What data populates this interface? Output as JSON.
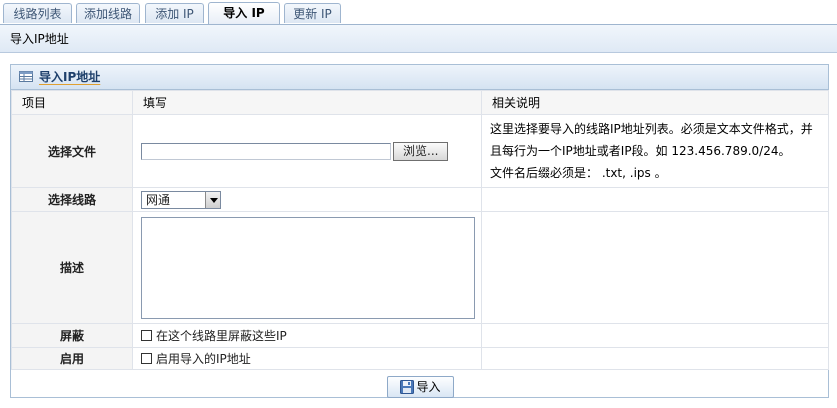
{
  "tabs": [
    {
      "label": "线路列表",
      "active": false
    },
    {
      "label": "添加线路",
      "active": false
    },
    {
      "label": "添加 IP",
      "active": false
    },
    {
      "label": "导入 IP",
      "active": true
    },
    {
      "label": "更新 IP",
      "active": false
    }
  ],
  "subheader": {
    "title": "导入IP地址"
  },
  "panel": {
    "title": "导入IP地址",
    "columns": {
      "item": "项目",
      "fill": "填写",
      "description": "相关说明"
    },
    "rows": {
      "file": {
        "label": "选择文件",
        "browse_label": "浏览...",
        "note_line1": "这里选择要导入的线路IP地址列表。必须是文本文件格式，并",
        "note_line2": "且每行为一个IP地址或者IP段。如 123.456.789.0/24。",
        "note_line3": "文件名后缀必须是： .txt, .ips 。"
      },
      "line": {
        "label": "选择线路",
        "selected": "网通"
      },
      "desc": {
        "label": "描述"
      },
      "block": {
        "label": "屏蔽",
        "checkbox_label": "在这个线路里屏蔽这些IP"
      },
      "enable": {
        "label": "启用",
        "checkbox_label": "启用导入的IP地址"
      }
    },
    "submit_label": "导入"
  },
  "colors": {
    "tab_border": "#9fb5cf",
    "panel_border": "#a9bfd6",
    "title_text": "#1d3f6b"
  }
}
